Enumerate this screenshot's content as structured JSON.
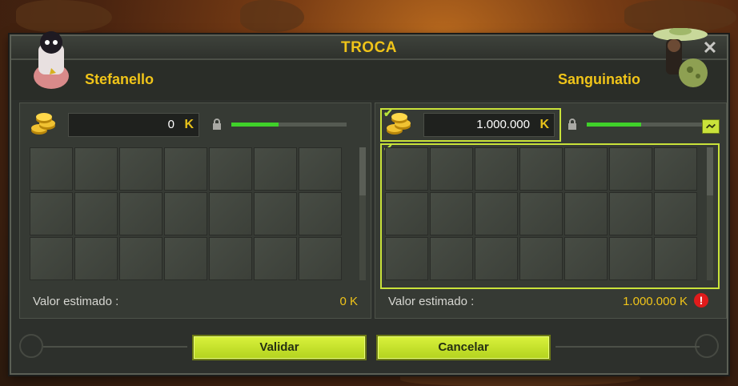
{
  "window": {
    "title": "TROCA",
    "close_symbol": "✕"
  },
  "left_player": {
    "name": "Stefanello",
    "kamas": "0",
    "kamas_currency_symbol": "K",
    "progress_fraction": 0.41,
    "estimated_value_label": "Valor estimado :",
    "estimated_value": "0 K",
    "slots": 21
  },
  "right_player": {
    "name": "Sanguinatio",
    "kamas": "1.000.000",
    "kamas_currency_symbol": "K",
    "progress_fraction": 0.47,
    "estimated_value_label": "Valor estimado :",
    "estimated_value": "1.000.000 K",
    "alert_symbol": "!",
    "check_symbol": "✔",
    "slots": 21
  },
  "buttons": {
    "validate_label": "Validar",
    "cancel_label": "Cancelar"
  },
  "colors": {
    "accent": "#f0c419",
    "button": "#c9e23a",
    "progress": "#3fd12a",
    "alert": "#e01b1b"
  }
}
